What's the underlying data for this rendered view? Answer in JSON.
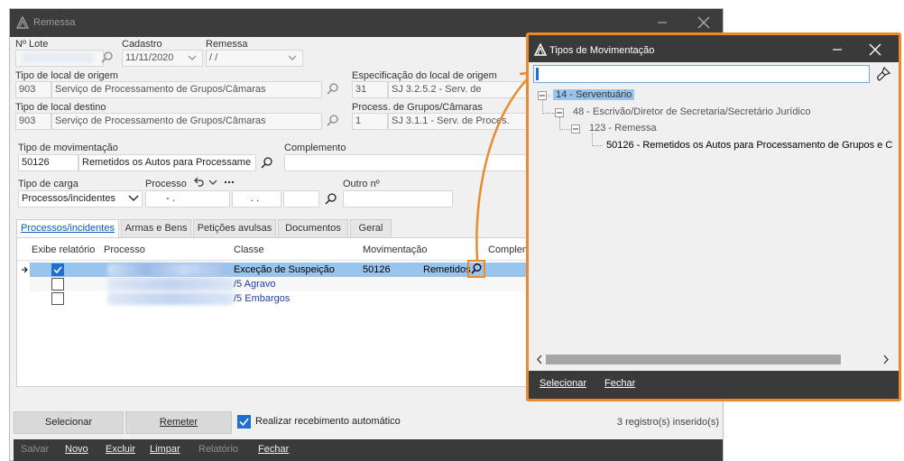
{
  "main": {
    "title": "Remessa",
    "labels": {
      "lote": "Nº Lote",
      "cadastro": "Cadastro",
      "remessa": "Remessa",
      "tipo_origem": "Tipo de local de origem",
      "especificacao_origem": "Especificação do local de origem",
      "tipo_destino": "Tipo de local destino",
      "process_grupos": "Process. de Grupos/Câmaras",
      "tipo_movimentacao": "Tipo de movimentação",
      "complemento": "Complemento",
      "tipo_carga": "Tipo de carga",
      "processo": "Processo",
      "outro_no": "Outro nº"
    },
    "fields": {
      "cadastro": "11/11/2020",
      "remessa": " /  /",
      "origem_code": "903",
      "origem_desc": "Serviço de Processamento de Grupos/Câmaras",
      "especificacao_code": "31",
      "especificacao_desc": "SJ 3.2.5.2 - Serv. de",
      "destino_code": "903",
      "destino_desc": "Serviço de Processamento de Grupos/Câmaras",
      "process_code": "1",
      "process_desc": "SJ 3.1.1 - Serv. de Proces.",
      "movimentacao_code": "50126",
      "movimentacao_desc": "Remetidos os Autos para Processame",
      "tipo_carga": "Processos/incidentes",
      "processo_1": "-  .",
      "processo_2": ". ."
    },
    "tabs": [
      "Processos/incidentes",
      "Armas e Bens",
      "Petições avulsas",
      "Documentos",
      "Geral"
    ],
    "grid": {
      "headers": [
        "Exibe relatório",
        "Processo",
        "Classe",
        "Movimentação",
        "Complem"
      ],
      "rows": [
        {
          "classe": "Exceção de Suspeição",
          "movimentacao": "50126",
          "complemento": "Remetidos",
          "checked": true
        },
        {
          "classe": "/5 Agravo",
          "movimentacao": "",
          "complemento": "",
          "checked": false
        },
        {
          "classe": "/5 Embargos",
          "movimentacao": "",
          "complemento": "",
          "checked": false
        }
      ]
    },
    "buttons": {
      "selecionar": "Selecionar",
      "remeter": "Remeter"
    },
    "auto_receive": "Realizar recebimento automático",
    "records": "3 registro(s) inserido(s)",
    "menu": [
      "Salvar",
      "Novo",
      "Excluir",
      "Limpar",
      "Relatório",
      "Fechar"
    ]
  },
  "dialog": {
    "title": "Tipos de Movimentação",
    "tree": [
      "14 - Serventuário",
      "48 - Escrivão/Diretor de Secretaria/Secretário Jurídico",
      "123 - Remessa",
      "50126 - Remetidos os Autos para Processamento de Grupos e C"
    ],
    "buttons": [
      "Selecionar",
      "Fechar"
    ]
  },
  "colors": {
    "accent": "#0a5bb8",
    "highlight": "#ea8a2b",
    "titlebar": "#3c3c3c",
    "selection": "#99c4ec"
  }
}
